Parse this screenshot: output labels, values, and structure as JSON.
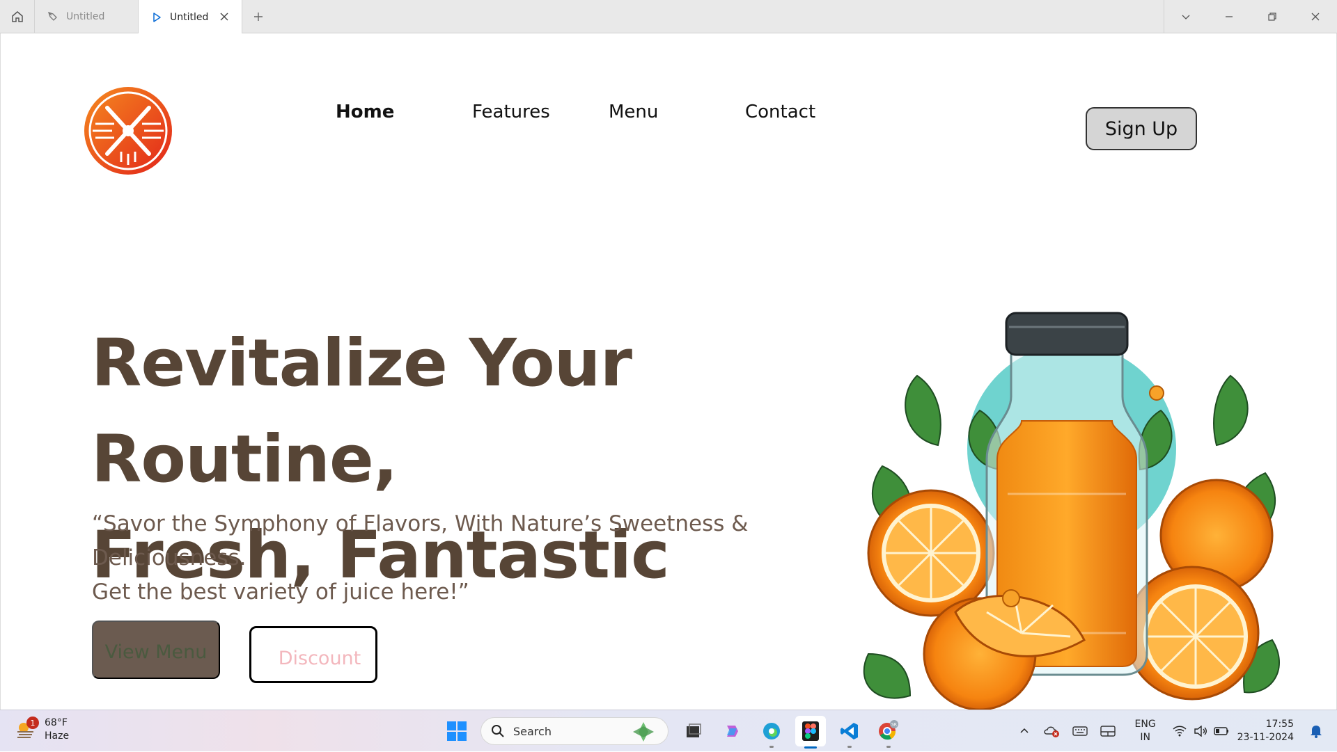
{
  "browser": {
    "tabs": [
      {
        "label": "Untitled",
        "active": false
      },
      {
        "label": "Untitled",
        "active": true
      }
    ]
  },
  "site": {
    "nav": {
      "home": "Home",
      "features": "Features",
      "menu": "Menu",
      "contact": "Contact"
    },
    "signup_label": "Sign Up",
    "hero": {
      "title_line1": "Revitalize Your Routine,",
      "title_line2": "Fresh, Fantastic",
      "subtitle_line1": "“Savor the Symphony of Flavors, With Nature’s Sweetness & Deliciousness.",
      "subtitle_line2": "Get the best variety of juice here!”",
      "view_menu_label": "View Menu",
      "discount_label": "Discount"
    },
    "colors": {
      "brand_orange": "#ef4a14",
      "title_brown": "#574536",
      "subtitle_brown": "#6d5a4e",
      "view_menu_bg": "#6b5b50",
      "discount_text": "#f3b7bd"
    }
  },
  "taskbar": {
    "weather": {
      "temp": "68°F",
      "condition": "Haze",
      "badge": "1"
    },
    "search_placeholder": "Search",
    "tray": {
      "lang_line1": "ENG",
      "lang_line2": "IN",
      "time": "17:55",
      "date": "23-11-2024"
    }
  }
}
